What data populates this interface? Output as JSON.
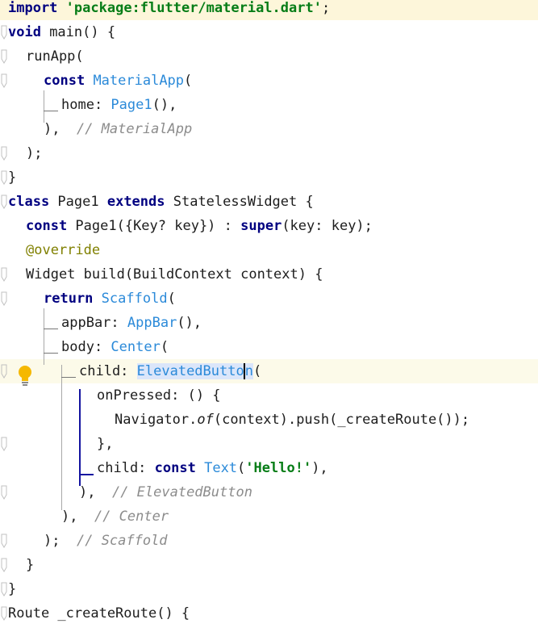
{
  "editor": {
    "language": "dart",
    "lines": [
      {
        "segments": [
          {
            "t": "import",
            "c": "kw"
          },
          {
            "t": " "
          },
          {
            "t": "'package:flutter/material.dart'",
            "c": "str"
          },
          {
            "t": ";"
          }
        ]
      },
      {
        "segments": [
          {
            "t": "void",
            "c": "kw"
          },
          {
            "t": " main() {"
          }
        ]
      },
      {
        "segments": [
          {
            "t": "runApp("
          }
        ]
      },
      {
        "segments": [
          {
            "t": "const",
            "c": "kw"
          },
          {
            "t": " "
          },
          {
            "t": "MaterialApp",
            "c": "cls"
          },
          {
            "t": "("
          }
        ]
      },
      {
        "segments": [
          {
            "t": "home: "
          },
          {
            "t": "Page1",
            "c": "cls"
          },
          {
            "t": "(),"
          }
        ]
      },
      {
        "segments": [
          {
            "t": "),  "
          },
          {
            "t": "// MaterialApp",
            "c": "cm"
          }
        ]
      },
      {
        "segments": [
          {
            "t": ");"
          }
        ]
      },
      {
        "segments": [
          {
            "t": "}"
          }
        ]
      },
      {
        "segments": [
          {
            "t": "class",
            "c": "kw"
          },
          {
            "t": " Page1 "
          },
          {
            "t": "extends",
            "c": "kw"
          },
          {
            "t": " StatelessWidget {"
          }
        ]
      },
      {
        "segments": [
          {
            "t": "const",
            "c": "kw"
          },
          {
            "t": " Page1({Key? key}) : "
          },
          {
            "t": "super",
            "c": "kw"
          },
          {
            "t": "(key: key);"
          }
        ]
      },
      {
        "segments": [
          {
            "t": "@override",
            "c": "an"
          }
        ]
      },
      {
        "segments": [
          {
            "t": "Widget build(BuildContext context) {"
          }
        ]
      },
      {
        "segments": [
          {
            "t": "return",
            "c": "kw"
          },
          {
            "t": " "
          },
          {
            "t": "Scaffold",
            "c": "cls"
          },
          {
            "t": "("
          }
        ]
      },
      {
        "segments": [
          {
            "t": "appBar: "
          },
          {
            "t": "AppBar",
            "c": "cls"
          },
          {
            "t": "(),"
          }
        ]
      },
      {
        "segments": [
          {
            "t": "body: "
          },
          {
            "t": "Center",
            "c": "cls"
          },
          {
            "t": "("
          }
        ]
      },
      {
        "segments": [
          {
            "t": "child: "
          },
          {
            "t": "ElevatedButton",
            "c": "cls sel",
            "caret_after": "ElevatedButto"
          },
          {
            "t": "("
          }
        ]
      },
      {
        "segments": [
          {
            "t": "onPressed: () {"
          }
        ]
      },
      {
        "segments": [
          {
            "t": "Navigator."
          },
          {
            "t": "of",
            "c": "it"
          },
          {
            "t": "(context).push(_createRoute());"
          }
        ]
      },
      {
        "segments": [
          {
            "t": "},"
          }
        ]
      },
      {
        "segments": [
          {
            "t": "child: "
          },
          {
            "t": "const",
            "c": "kw"
          },
          {
            "t": " "
          },
          {
            "t": "Text",
            "c": "cls"
          },
          {
            "t": "("
          },
          {
            "t": "'Hello!'",
            "c": "str"
          },
          {
            "t": "),"
          }
        ]
      },
      {
        "segments": [
          {
            "t": "),  "
          },
          {
            "t": "// ElevatedButton",
            "c": "cm"
          }
        ]
      },
      {
        "segments": [
          {
            "t": "),  "
          },
          {
            "t": "// Center",
            "c": "cm"
          }
        ]
      },
      {
        "segments": [
          {
            "t": ");  "
          },
          {
            "t": "// Scaffold",
            "c": "cm"
          }
        ]
      },
      {
        "segments": [
          {
            "t": "}"
          }
        ]
      },
      {
        "segments": [
          {
            "t": "}"
          }
        ]
      },
      {
        "segments": [
          {
            "t": "Route _createRoute() {"
          }
        ]
      }
    ]
  },
  "intention_action": {
    "icon": "lightbulb-icon",
    "color": "#f5b800"
  },
  "colors": {
    "keyword": "#000080",
    "string": "#067d17",
    "class": "#2b8ad9",
    "comment": "#8c8c8c",
    "annotation": "#808000"
  }
}
